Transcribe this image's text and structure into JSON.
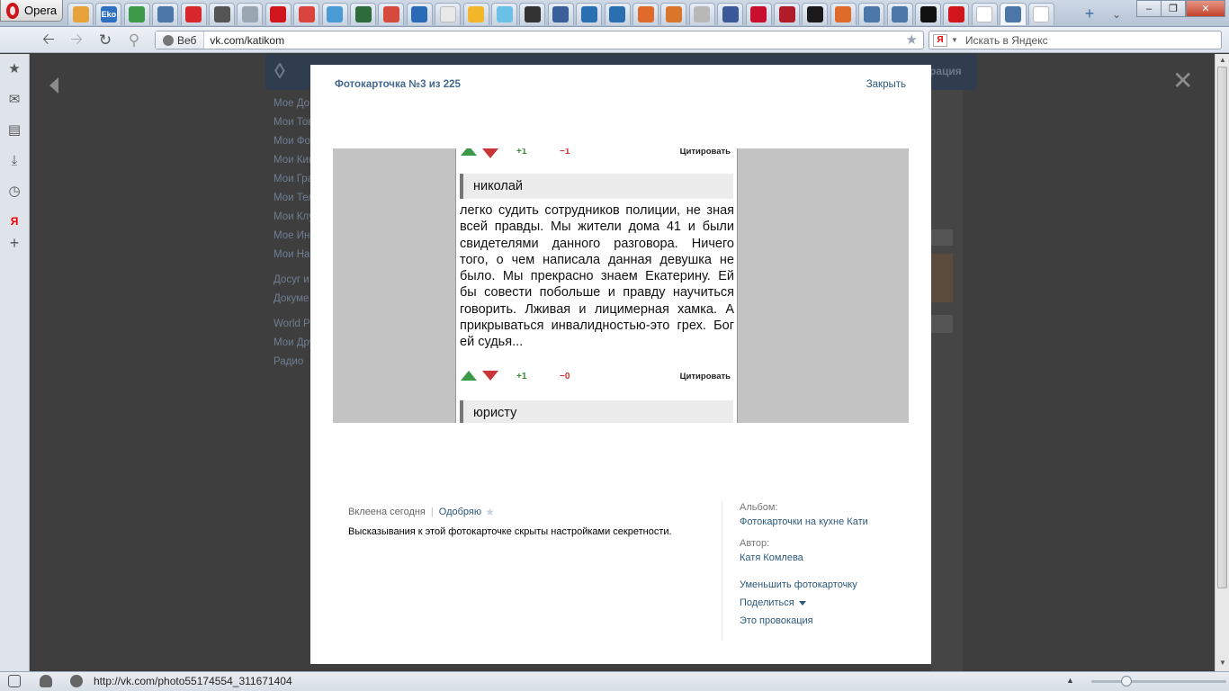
{
  "browser": {
    "menu_label": "Opera",
    "tabs": [
      {
        "icon": "opera-mail-icon",
        "color": "#e8a23a",
        "text": ""
      },
      {
        "icon": "eko-icon",
        "color": "#2f6fc0",
        "text": "Eko"
      },
      {
        "icon": "colorful-icon",
        "color": "#3c9a4a",
        "text": ""
      },
      {
        "icon": "vk-icon",
        "color": "#4a76a8",
        "text": ""
      },
      {
        "icon": "red-circle-icon",
        "color": "#d8262d",
        "text": ""
      },
      {
        "icon": "news-icon",
        "color": "#555555",
        "text": ""
      },
      {
        "icon": "blank-page-icon",
        "color": "#9aa6b2",
        "text": ""
      },
      {
        "icon": "yap-icon",
        "color": "#d0151c",
        "text": ""
      },
      {
        "icon": "sport-icon",
        "color": "#d9453c",
        "text": ""
      },
      {
        "icon": "globe-icon",
        "color": "#4a9ad6",
        "text": ""
      },
      {
        "icon": "eto-icon",
        "color": "#2d6b3a",
        "text": ""
      },
      {
        "icon": "mail-m-icon",
        "color": "#d54a3a",
        "text": ""
      },
      {
        "icon": "shield-icon",
        "color": "#2a6ab8",
        "text": ""
      },
      {
        "icon": "google-icon",
        "color": "#e8e8e8",
        "text": ""
      },
      {
        "icon": "sun-icon",
        "color": "#f2b72b",
        "text": ""
      },
      {
        "icon": "water-icon",
        "color": "#6ac0e6",
        "text": ""
      },
      {
        "icon": "wheel-icon",
        "color": "#333333",
        "text": ""
      },
      {
        "icon": "ship-icon",
        "color": "#3a5f9a",
        "text": ""
      },
      {
        "icon": "eagle-icon",
        "color": "#2a6fb2",
        "text": ""
      },
      {
        "icon": "n-icon",
        "color": "#2a6fb2",
        "text": ""
      },
      {
        "icon": "ball-icon",
        "color": "#e06a2a",
        "text": ""
      },
      {
        "icon": "house-icon",
        "color": "#d9762a",
        "text": ""
      },
      {
        "icon": "book-icon",
        "color": "#b8b8b8",
        "text": ""
      },
      {
        "icon": "facebook-icon",
        "color": "#3b5998",
        "text": ""
      },
      {
        "icon": "cart-icon",
        "color": "#c8102e",
        "text": ""
      },
      {
        "icon": "flag-icon",
        "color": "#b01c2a",
        "text": ""
      },
      {
        "icon": "radar-icon",
        "color": "#1a1a1a",
        "text": ""
      },
      {
        "icon": "ball2-icon",
        "color": "#e06a2a",
        "text": ""
      },
      {
        "icon": "vk2-icon",
        "color": "#4a76a8",
        "text": ""
      },
      {
        "icon": "vk3-icon",
        "color": "#4a76a8",
        "text": ""
      },
      {
        "icon": "s-icon",
        "color": "#111111",
        "text": ""
      },
      {
        "icon": "yap2-icon",
        "color": "#d0151c",
        "text": ""
      },
      {
        "icon": "yandex-icon",
        "color": "#ffffff",
        "text": ""
      },
      {
        "icon": "vk-active-icon",
        "color": "#4a76a8",
        "text": ""
      },
      {
        "icon": "flag2-icon",
        "color": "#ffffff",
        "text": ""
      }
    ],
    "address": {
      "web_label": "Веб",
      "url": "vk.com/katikom"
    },
    "search": {
      "engine": "Я",
      "placeholder": "Искать в Яндекс"
    },
    "status_url": "http://vk.com/photo55174554_311671404"
  },
  "background_page": {
    "menu": [
      "Мое До",
      "Мои Тов",
      "Мои Фот",
      "Мои Кин",
      "Мои Гра",
      "Мои Тел",
      "Мои Клу",
      "Мое Инс",
      "Мои Нас",
      "Досуг и",
      "Докуме",
      "World Po",
      "Мои Дру",
      "Радио"
    ],
    "header_right": "рация"
  },
  "modal": {
    "title": "Фотокарточка №3 из 225",
    "close_label": "Закрыть",
    "photo": {
      "top_votes": {
        "plus": "+1",
        "minus": "−1",
        "quote": "Цитировать"
      },
      "author": "николай",
      "comment": "легко судить сотрудников полиции, не зная всей правды. Мы жители дома 41 и были свидетелями данного разговора. Ничего того, о чем написала данная девушка не было. Мы прекрасно знаем Екатерину. Ей бы совести побольше и правду научиться говорить. Лживая и лицимерная хамка. А прикрываться инвалидностью-это грех. Бог ей судья...",
      "bottom_votes": {
        "plus": "+1",
        "minus": "−0",
        "quote": "Цитировать"
      },
      "next_author": "юристу"
    },
    "added": "Вклеена сегодня",
    "like_label": "Одобряю",
    "privacy_note": "Высказывания к этой фотокарточке скрыты настройками секретности.",
    "album_label": "Альбом:",
    "album_name": "Фотокарточки на кухне Кати",
    "author_label": "Автор:",
    "author_name": "Катя Комлева",
    "actions": {
      "shrink": "Уменьшить фотокарточку",
      "share": "Поделиться",
      "report": "Это провокация"
    }
  }
}
